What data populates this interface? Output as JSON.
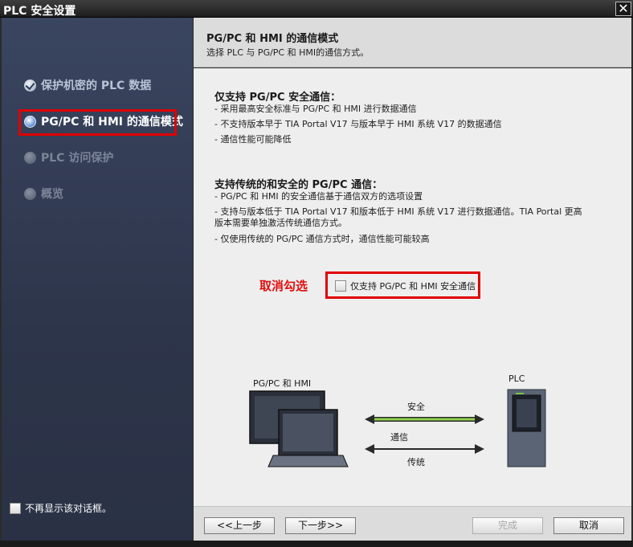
{
  "window": {
    "title": "PLC 安全设置",
    "close_glyph": "✕"
  },
  "sidebar": {
    "items": [
      {
        "label": "保护机密的 PLC 数据",
        "state": "done"
      },
      {
        "label": "PG/PC 和 HMI 的通信模式",
        "state": "active"
      },
      {
        "label": "PLC 访问保护",
        "state": "pending"
      },
      {
        "label": "概览",
        "state": "pending"
      }
    ],
    "dont_show_label": "不再显示该对话框。",
    "dont_show_checked": false
  },
  "header": {
    "title": "PG/PC 和 HMI 的通信模式",
    "subtitle": "选择 PLC 与 PG/PC 和 HMI的通信方式。"
  },
  "content": {
    "section1": {
      "title": "仅支持 PG/PC 安全通信：",
      "lines": [
        "- 采用最高安全标准与 PG/PC 和 HMI 进行数据通信",
        "- 不支持版本早于 TIA Portal V17 与版本早于 HMI 系统 V17 的数据通信",
        "- 通信性能可能降低"
      ]
    },
    "section2": {
      "title": "支持传统的和安全的 PG/PC 通信：",
      "lines": [
        "- PG/PC 和 HMI 的安全通信基于通信双方的选项设置",
        "- 支持与版本低于 TIA Portal V17 和版本低于 HMI 系统 V17 进行数据通信。TIA Portal 更高",
        "版本需要单独激活传统通信方式。",
        "- 仅使用传统的 PG/PC 通信方式时，通信性能可能较高"
      ]
    },
    "annotation": "取消勾选",
    "option": {
      "label": "仅支持 PG/PC 和 HMI 安全通信",
      "checked": false
    },
    "diagram": {
      "left_label": "PG/PC 和 HMI",
      "right_label": "PLC",
      "secure_label": "安全",
      "comm_label": "通信",
      "legacy_label": "传统"
    }
  },
  "footer": {
    "back": "<<上一步",
    "next": "下一步>>",
    "finish": "完成",
    "cancel": "取消",
    "finish_enabled": false
  },
  "colors": {
    "sidebar_bg": "#2d354a",
    "highlight_red": "#e00000",
    "secure_link_green": "#8fd14f"
  }
}
